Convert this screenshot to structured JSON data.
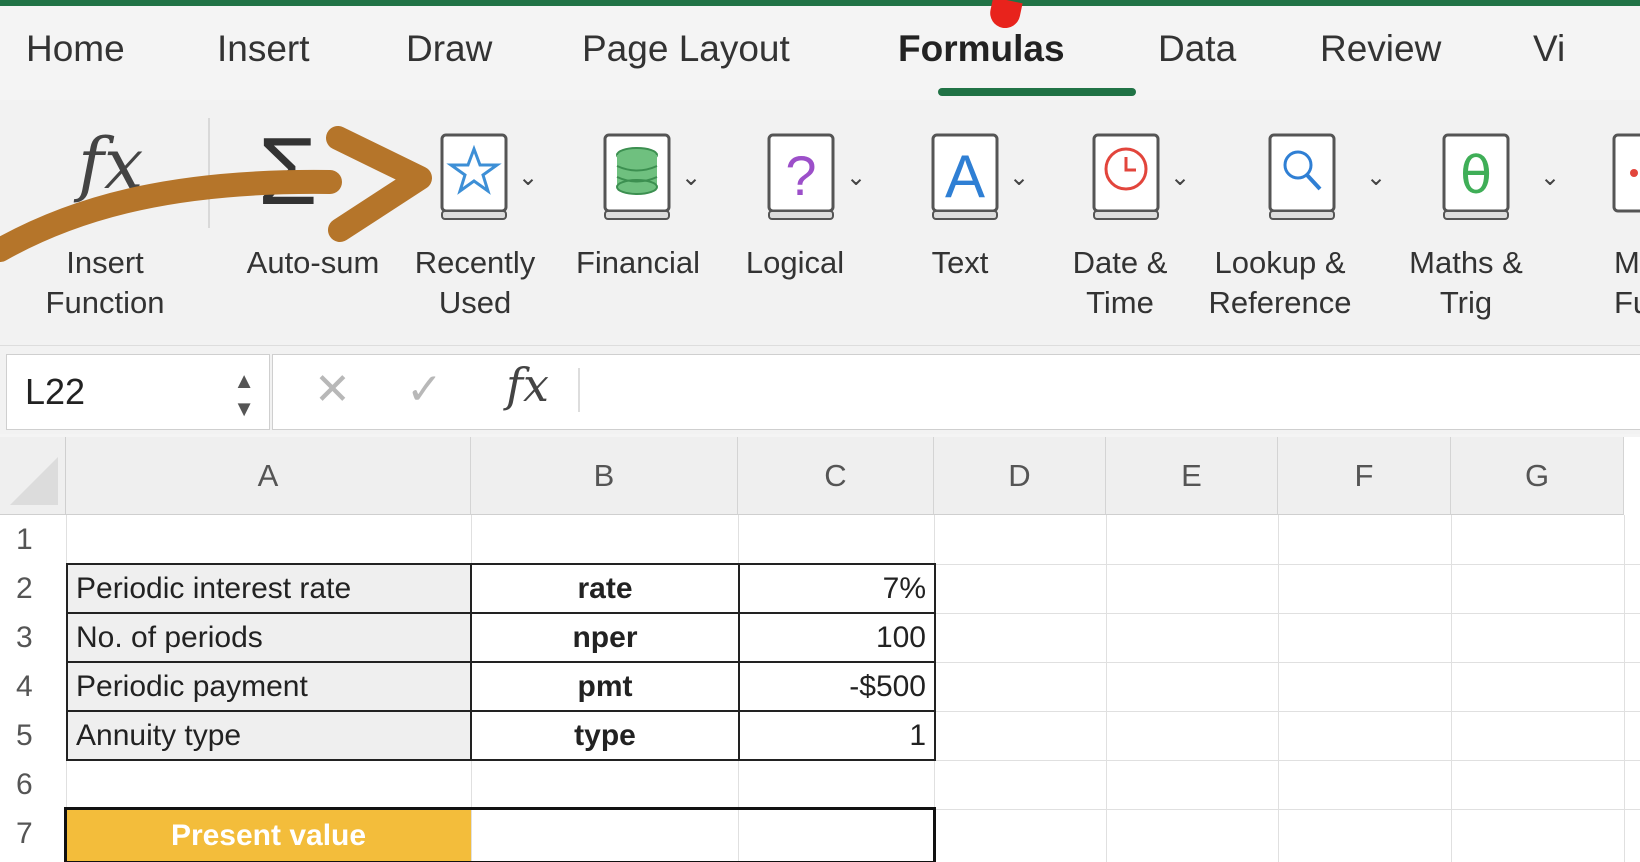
{
  "tabs": [
    "Home",
    "Insert",
    "Draw",
    "Page Layout",
    "Formulas",
    "Data",
    "Review",
    "Vi"
  ],
  "active_tab": "Formulas",
  "ribbon": {
    "insert_function": {
      "icon": "fx",
      "label1": "Insert",
      "label2": "Function"
    },
    "autosum": {
      "icon": "Σ",
      "label1": "Auto-sum"
    },
    "recently_used": {
      "label1": "Recently",
      "label2": "Used",
      "icon": "star-icon",
      "color": "#3d8fd6"
    },
    "financial": {
      "label1": "Financial",
      "icon": "coins-icon",
      "color": "#4aa564"
    },
    "logical": {
      "label1": "Logical",
      "icon": "question-icon",
      "glyph": "?",
      "color": "#9c4fc9"
    },
    "text": {
      "label1": "Text",
      "icon": "text-a-icon",
      "glyph": "A",
      "color": "#2f7fd4"
    },
    "date_time": {
      "label1": "Date &",
      "label2": "Time",
      "icon": "clock-icon",
      "color": "#e2453c"
    },
    "lookup": {
      "label1": "Lookup &",
      "label2": "Reference",
      "icon": "magnifier-icon",
      "color": "#2f7fd4"
    },
    "maths": {
      "label1": "Maths &",
      "label2": "Trig",
      "icon": "theta-icon",
      "glyph": "θ",
      "color": "#3fae57"
    },
    "more": {
      "label1": "M",
      "label2": "Fu"
    }
  },
  "formula_bar": {
    "name_box": "L22",
    "cancel": "✕",
    "confirm": "✓",
    "fx": "fx",
    "value": ""
  },
  "columns": [
    "A",
    "B",
    "C",
    "D",
    "E",
    "F",
    "G"
  ],
  "rows": [
    "1",
    "2",
    "3",
    "4",
    "5",
    "6",
    "7"
  ],
  "table": [
    {
      "label": "Periodic interest rate",
      "key": "rate",
      "value": "7%"
    },
    {
      "label": "No. of periods",
      "key": "nper",
      "value": "100"
    },
    {
      "label": "Periodic payment",
      "key": "pmt",
      "value": "-$500"
    },
    {
      "label": "Annuity type",
      "key": "type",
      "value": "1"
    }
  ],
  "present_value": {
    "label": "Present value",
    "value": ""
  },
  "colors": {
    "accent": "#217346",
    "highlight": "#f3bd3b",
    "arrow": "#b5752a",
    "marker": "#e8231c"
  }
}
